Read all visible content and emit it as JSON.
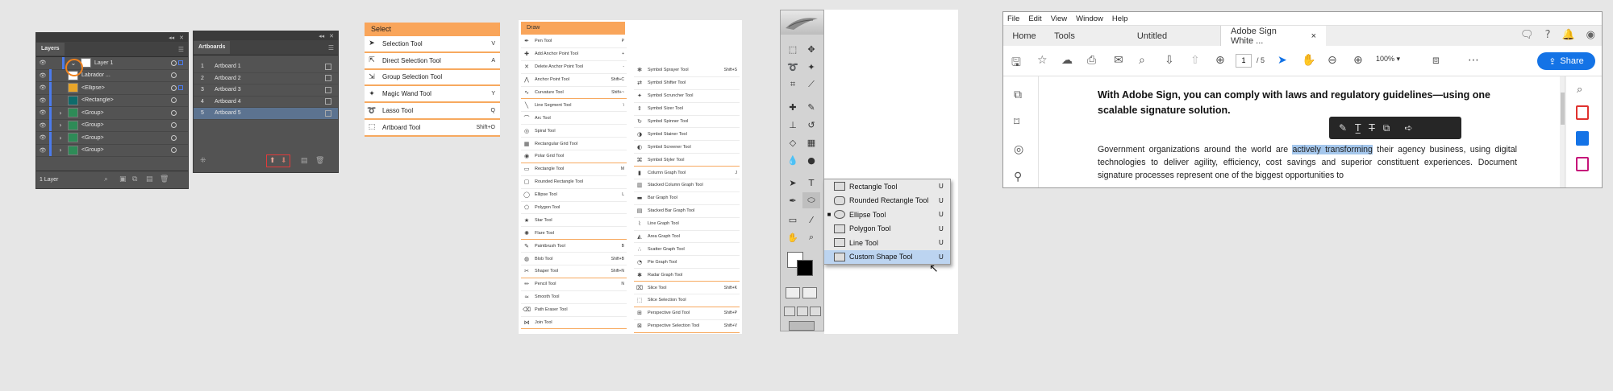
{
  "layers_panel": {
    "tab": "Layers",
    "rows": [
      {
        "name": "Layer 1",
        "arrow": "⌄",
        "thumb": "#ffffff"
      },
      {
        "name": "Labrador ...",
        "arrow": "",
        "thumb": "#ffffff"
      },
      {
        "name": "<Ellipse>",
        "arrow": "",
        "thumb": "#e8a52a"
      },
      {
        "name": "<Rectangle>",
        "arrow": "",
        "thumb": "#0e6b6b"
      },
      {
        "name": "<Group>",
        "arrow": "›",
        "thumb": "#2e8b57"
      },
      {
        "name": "<Group>",
        "arrow": "›",
        "thumb": "#2e8b57"
      },
      {
        "name": "<Group>",
        "arrow": "›",
        "thumb": "#2e8b57"
      },
      {
        "name": "<Group>",
        "arrow": "›",
        "thumb": "#2e8b57"
      }
    ],
    "footer": "1 Layer",
    "highlight_color": "#f0821e"
  },
  "artboards_panel": {
    "tab": "Artboards",
    "rows": [
      {
        "num": "1",
        "name": "Artboard 1"
      },
      {
        "num": "2",
        "name": "Artboard 2"
      },
      {
        "num": "3",
        "name": "Artboard 3"
      },
      {
        "num": "4",
        "name": "Artboard 4"
      },
      {
        "num": "5",
        "name": "Artboard 5"
      }
    ],
    "selected_index": 4
  },
  "select_menu": {
    "title": "Select",
    "items": [
      {
        "label": "Selection Tool",
        "key": "V",
        "icon": "arrow-icon"
      },
      {
        "label": "Direct Selection Tool",
        "key": "A",
        "icon": "direct-arrow-icon"
      },
      {
        "label": "Group Selection Tool",
        "key": "",
        "icon": "group-arrow-icon"
      },
      {
        "label": "Magic Wand Tool",
        "key": "Y",
        "icon": "wand-icon"
      },
      {
        "label": "Lasso Tool",
        "key": "Q",
        "icon": "lasso-icon"
      },
      {
        "label": "Artboard Tool",
        "key": "Shift+O",
        "icon": "artboard-icon"
      }
    ]
  },
  "draw_menu": {
    "title": "Draw",
    "col1": [
      {
        "label": "Pen Tool",
        "key": "P"
      },
      {
        "label": "Add Anchor Point Tool",
        "key": "+"
      },
      {
        "label": "Delete Anchor Point Tool",
        "key": "-"
      },
      {
        "label": "Anchor Point Tool",
        "key": "Shift+C"
      },
      {
        "label": "Curvature Tool",
        "key": "Shift+~"
      },
      {
        "label": "Line Segment Tool",
        "key": "\\"
      },
      {
        "label": "Arc Tool",
        "key": ""
      },
      {
        "label": "Spiral Tool",
        "key": ""
      },
      {
        "label": "Rectangular Grid Tool",
        "key": ""
      },
      {
        "label": "Polar Grid Tool",
        "key": ""
      },
      {
        "label": "Rectangle Tool",
        "key": "M"
      },
      {
        "label": "Rounded Rectangle Tool",
        "key": ""
      },
      {
        "label": "Ellipse Tool",
        "key": "L"
      },
      {
        "label": "Polygon Tool",
        "key": ""
      },
      {
        "label": "Star Tool",
        "key": ""
      },
      {
        "label": "Flare Tool",
        "key": ""
      },
      {
        "label": "Paintbrush Tool",
        "key": "B"
      },
      {
        "label": "Blob Tool",
        "key": "Shift+B"
      },
      {
        "label": "Shaper Tool",
        "key": "Shift+N"
      },
      {
        "label": "Pencil Tool",
        "key": "N"
      },
      {
        "label": "Smooth Tool",
        "key": ""
      },
      {
        "label": "Path Eraser Tool",
        "key": ""
      },
      {
        "label": "Join Tool",
        "key": ""
      }
    ],
    "col2": [
      {
        "label": "Symbol Sprayer Tool",
        "key": "Shift+S"
      },
      {
        "label": "Symbol Shifter Tool",
        "key": ""
      },
      {
        "label": "Symbol Scruncher Tool",
        "key": ""
      },
      {
        "label": "Symbol Sizer Tool",
        "key": ""
      },
      {
        "label": "Symbol Spinner Tool",
        "key": ""
      },
      {
        "label": "Symbol Stainer Tool",
        "key": ""
      },
      {
        "label": "Symbol Screener Tool",
        "key": ""
      },
      {
        "label": "Symbol Styler Tool",
        "key": ""
      },
      {
        "label": "Column Graph Tool",
        "key": "J"
      },
      {
        "label": "Stacked Column Graph Tool",
        "key": ""
      },
      {
        "label": "Bar Graph Tool",
        "key": ""
      },
      {
        "label": "Stacked Bar Graph Tool",
        "key": ""
      },
      {
        "label": "Line Graph Tool",
        "key": ""
      },
      {
        "label": "Area Graph Tool",
        "key": ""
      },
      {
        "label": "Scatter Graph Tool",
        "key": ""
      },
      {
        "label": "Pie Graph Tool",
        "key": ""
      },
      {
        "label": "Radar Graph Tool",
        "key": ""
      },
      {
        "label": "Slice Tool",
        "key": "Shift+K"
      },
      {
        "label": "Slice Selection Tool",
        "key": ""
      },
      {
        "label": "Perspective Grid Tool",
        "key": "Shift+P"
      },
      {
        "label": "Perspective Selection Tool",
        "key": "Shift+V"
      }
    ]
  },
  "ps_flyout": {
    "items": [
      {
        "label": "Rectangle Tool",
        "key": "U",
        "active": false,
        "current": false
      },
      {
        "label": "Rounded Rectangle Tool",
        "key": "U",
        "active": false,
        "current": false
      },
      {
        "label": "Ellipse Tool",
        "key": "U",
        "active": false,
        "current": true
      },
      {
        "label": "Polygon Tool",
        "key": "U",
        "active": false,
        "current": false
      },
      {
        "label": "Line Tool",
        "key": "U",
        "active": false,
        "current": false
      },
      {
        "label": "Custom Shape Tool",
        "key": "U",
        "active": true,
        "current": false
      }
    ]
  },
  "acrobat": {
    "menu": [
      "File",
      "Edit",
      "View",
      "Window",
      "Help"
    ],
    "tabs": {
      "home": "Home",
      "tools": "Tools",
      "untitled": "Untitled",
      "doc": "Adobe Sign White ...",
      "close": "×"
    },
    "page_current": "1",
    "page_total": "/ 5",
    "zoom": "100%",
    "share": "Share",
    "heading": "With Adobe Sign, you can comply with laws and regulatory guidelines—using one scalable signature solution.",
    "body_before": "Government organizations around the world are ",
    "body_highlight": "actively transforming",
    "body_after": " their agency business, using digital technologies to deliver agility, efficiency, cost savings and superior constituent experiences. Document signature processes represent one of the biggest opportunities to",
    "brand_color": "#1473e6"
  }
}
